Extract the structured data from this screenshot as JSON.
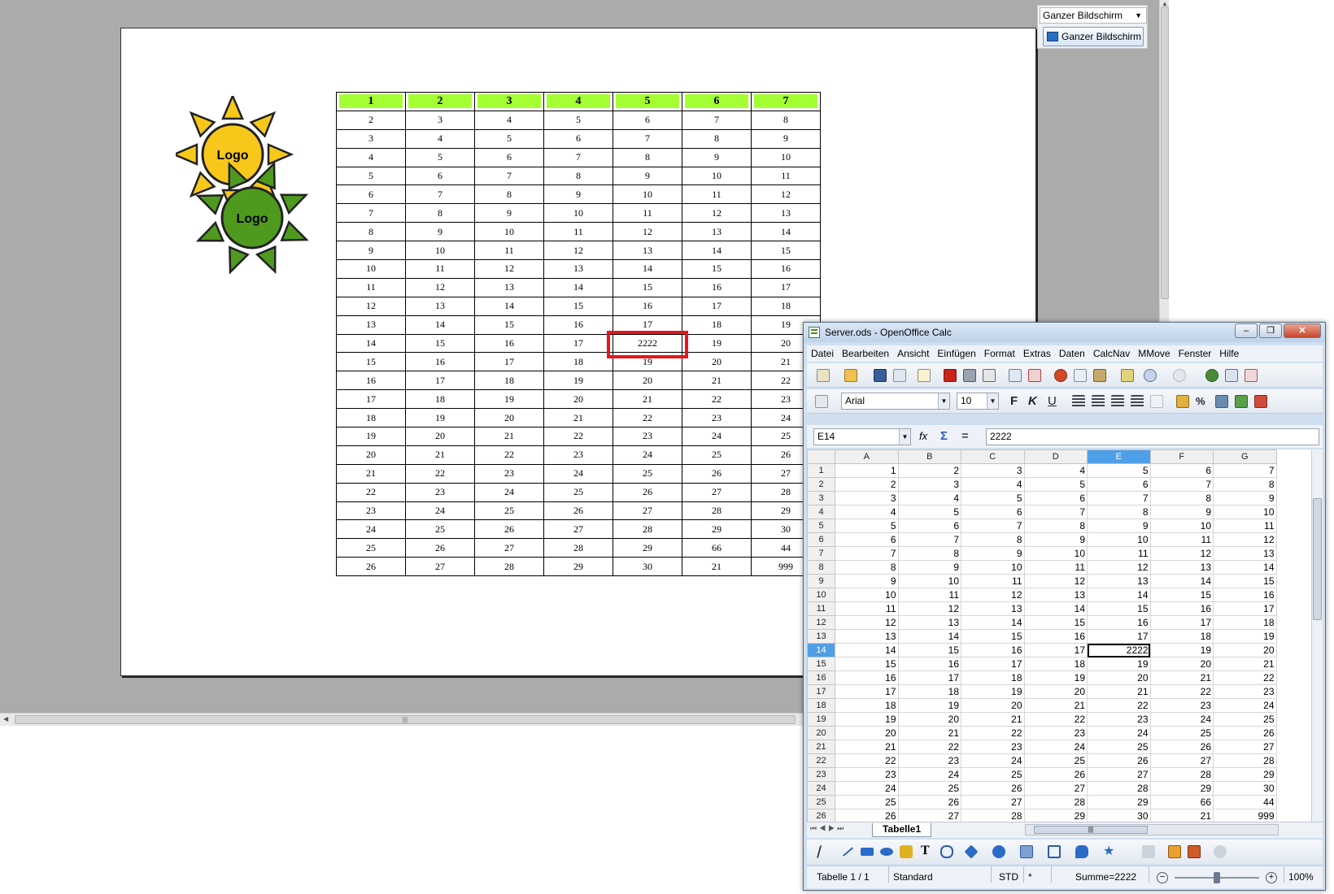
{
  "presentation": {
    "combo_label": "Ganzer Bildschirm",
    "button_label": "Ganzer Bildschirm",
    "sun_labels": [
      "Logo",
      "Logo"
    ],
    "table_header": [
      "1",
      "2",
      "3",
      "4",
      "5",
      "6",
      "7"
    ],
    "table_rows": [
      [
        "2",
        "3",
        "4",
        "5",
        "6",
        "7",
        "8"
      ],
      [
        "3",
        "4",
        "5",
        "6",
        "7",
        "8",
        "9"
      ],
      [
        "4",
        "5",
        "6",
        "7",
        "8",
        "9",
        "10"
      ],
      [
        "5",
        "6",
        "7",
        "8",
        "9",
        "10",
        "11"
      ],
      [
        "6",
        "7",
        "8",
        "9",
        "10",
        "11",
        "12"
      ],
      [
        "7",
        "8",
        "9",
        "10",
        "11",
        "12",
        "13"
      ],
      [
        "8",
        "9",
        "10",
        "11",
        "12",
        "13",
        "14"
      ],
      [
        "9",
        "10",
        "11",
        "12",
        "13",
        "14",
        "15"
      ],
      [
        "10",
        "11",
        "12",
        "13",
        "14",
        "15",
        "16"
      ],
      [
        "11",
        "12",
        "13",
        "14",
        "15",
        "16",
        "17"
      ],
      [
        "12",
        "13",
        "14",
        "15",
        "16",
        "17",
        "18"
      ],
      [
        "13",
        "14",
        "15",
        "16",
        "17",
        "18",
        "19"
      ],
      [
        "14",
        "15",
        "16",
        "17",
        "2222",
        "19",
        "20"
      ],
      [
        "15",
        "16",
        "17",
        "18",
        "19",
        "20",
        "21"
      ],
      [
        "16",
        "17",
        "18",
        "19",
        "20",
        "21",
        "22"
      ],
      [
        "17",
        "18",
        "19",
        "20",
        "21",
        "22",
        "23"
      ],
      [
        "18",
        "19",
        "20",
        "21",
        "22",
        "23",
        "24"
      ],
      [
        "19",
        "20",
        "21",
        "22",
        "23",
        "24",
        "25"
      ],
      [
        "20",
        "21",
        "22",
        "23",
        "24",
        "25",
        "26"
      ],
      [
        "21",
        "22",
        "23",
        "24",
        "25",
        "26",
        "27"
      ],
      [
        "22",
        "23",
        "24",
        "25",
        "26",
        "27",
        "28"
      ],
      [
        "23",
        "24",
        "25",
        "26",
        "27",
        "28",
        "29"
      ],
      [
        "24",
        "25",
        "26",
        "27",
        "28",
        "29",
        "30"
      ],
      [
        "25",
        "26",
        "27",
        "28",
        "29",
        "66",
        "44"
      ],
      [
        "26",
        "27",
        "28",
        "29",
        "30",
        "21",
        "999"
      ]
    ],
    "colors": {
      "header_fill": "#a4ff33",
      "highlight": "#e8141c",
      "sun_yellow": "#f7c81a",
      "sun_green": "#4f9a1e"
    }
  },
  "calc": {
    "title": "Server.ods - OpenOffice Calc",
    "window_buttons": [
      "–",
      "❐",
      "✕"
    ],
    "menu": [
      "Datei",
      "Bearbeiten",
      "Ansicht",
      "Einfügen",
      "Format",
      "Extras",
      "Daten",
      "CalcNav",
      "MMove",
      "Fenster",
      "Hilfe"
    ],
    "font_name": "Arial",
    "font_size": "10",
    "name_box": "E14",
    "formula_value": "2222",
    "formula_symbols": {
      "fx": "fx",
      "sum": "Σ",
      "eq": "="
    },
    "columns": [
      "A",
      "B",
      "C",
      "D",
      "E",
      "F",
      "G"
    ],
    "selected_column": "E",
    "selected_row": "14",
    "rows": [
      [
        "1",
        "1",
        "2",
        "3",
        "4",
        "5",
        "6",
        "7"
      ],
      [
        "2",
        "2",
        "3",
        "4",
        "5",
        "6",
        "7",
        "8"
      ],
      [
        "3",
        "3",
        "4",
        "5",
        "6",
        "7",
        "8",
        "9"
      ],
      [
        "4",
        "4",
        "5",
        "6",
        "7",
        "8",
        "9",
        "10"
      ],
      [
        "5",
        "5",
        "6",
        "7",
        "8",
        "9",
        "10",
        "11"
      ],
      [
        "6",
        "6",
        "7",
        "8",
        "9",
        "10",
        "11",
        "12"
      ],
      [
        "7",
        "7",
        "8",
        "9",
        "10",
        "11",
        "12",
        "13"
      ],
      [
        "8",
        "8",
        "9",
        "10",
        "11",
        "12",
        "13",
        "14"
      ],
      [
        "9",
        "9",
        "10",
        "11",
        "12",
        "13",
        "14",
        "15"
      ],
      [
        "10",
        "10",
        "11",
        "12",
        "13",
        "14",
        "15",
        "16"
      ],
      [
        "11",
        "11",
        "12",
        "13",
        "14",
        "15",
        "16",
        "17"
      ],
      [
        "12",
        "12",
        "13",
        "14",
        "15",
        "16",
        "17",
        "18"
      ],
      [
        "13",
        "13",
        "14",
        "15",
        "16",
        "17",
        "18",
        "19"
      ],
      [
        "14",
        "14",
        "15",
        "16",
        "17",
        "2222",
        "19",
        "20"
      ],
      [
        "15",
        "15",
        "16",
        "17",
        "18",
        "19",
        "20",
        "21"
      ],
      [
        "16",
        "16",
        "17",
        "18",
        "19",
        "20",
        "21",
        "22"
      ],
      [
        "17",
        "17",
        "18",
        "19",
        "20",
        "21",
        "22",
        "23"
      ],
      [
        "18",
        "18",
        "19",
        "20",
        "21",
        "22",
        "23",
        "24"
      ],
      [
        "19",
        "19",
        "20",
        "21",
        "22",
        "23",
        "24",
        "25"
      ],
      [
        "20",
        "20",
        "21",
        "22",
        "23",
        "24",
        "25",
        "26"
      ],
      [
        "21",
        "21",
        "22",
        "23",
        "24",
        "25",
        "26",
        "27"
      ],
      [
        "22",
        "22",
        "23",
        "24",
        "25",
        "26",
        "27",
        "28"
      ],
      [
        "23",
        "23",
        "24",
        "25",
        "26",
        "27",
        "28",
        "29"
      ],
      [
        "24",
        "24",
        "25",
        "26",
        "27",
        "28",
        "29",
        "30"
      ],
      [
        "25",
        "25",
        "26",
        "27",
        "28",
        "29",
        "66",
        "44"
      ],
      [
        "26",
        "26",
        "27",
        "28",
        "29",
        "30",
        "21",
        "999"
      ]
    ],
    "sheet_tab": "Tabelle1",
    "status": {
      "sheet": "Tabelle 1 / 1",
      "style": "Standard",
      "mode": "STD",
      "modified": "*",
      "sum": "Summe=2222",
      "zoom": "100%"
    }
  }
}
